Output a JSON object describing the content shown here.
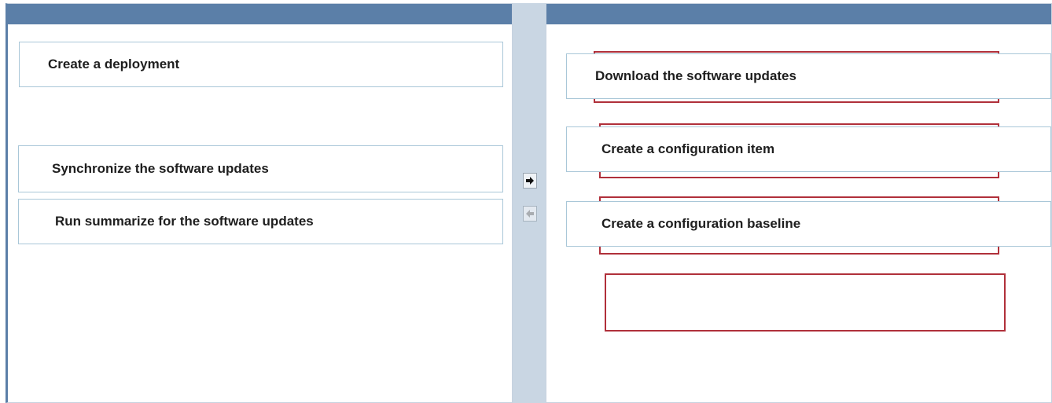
{
  "left_items": [
    {
      "label": "Create a deployment"
    },
    {
      "label": "Synchronize the software updates"
    },
    {
      "label": "Run summarize for the software updates"
    }
  ],
  "right_items": [
    {
      "label": "Download the software updates"
    },
    {
      "label": "Create a configuration item"
    },
    {
      "label": "Create a configuration baseline"
    }
  ],
  "controls": {
    "move_right_icon": "right-arrow-icon",
    "move_left_icon": "left-arrow-icon"
  },
  "colors": {
    "header": "#5b7fa8",
    "divider": "#c9d6e3",
    "item_border": "#a9c7d8",
    "slot_border": "#b0303a"
  }
}
